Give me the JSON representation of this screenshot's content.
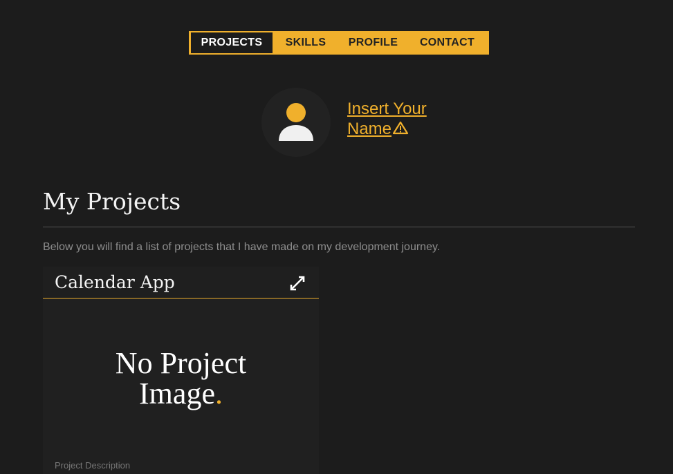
{
  "nav": {
    "items": [
      {
        "label": "PROJECTS",
        "active": true
      },
      {
        "label": "SKILLS",
        "active": false
      },
      {
        "label": "PROFILE",
        "active": false
      },
      {
        "label": "CONTACT",
        "active": false
      }
    ]
  },
  "profile": {
    "name_line1": "Insert Your",
    "name_line2": "Name",
    "avatar_icon": "user-icon",
    "warning_icon": "warning-icon"
  },
  "projects": {
    "title": "My Projects",
    "intro": "Below you will find a list of projects that I have made on my development journey.",
    "cards": [
      {
        "title": "Calendar App",
        "expand_icon": "expand-icon",
        "image_placeholder_line1": "No Project",
        "image_placeholder_line2": "Image",
        "image_placeholder_dot": ".",
        "description": "Project Description"
      }
    ]
  },
  "colors": {
    "accent": "#f0b02c",
    "background": "#1c1c1c",
    "card": "#202020",
    "muted_text": "#8e8e8e"
  }
}
